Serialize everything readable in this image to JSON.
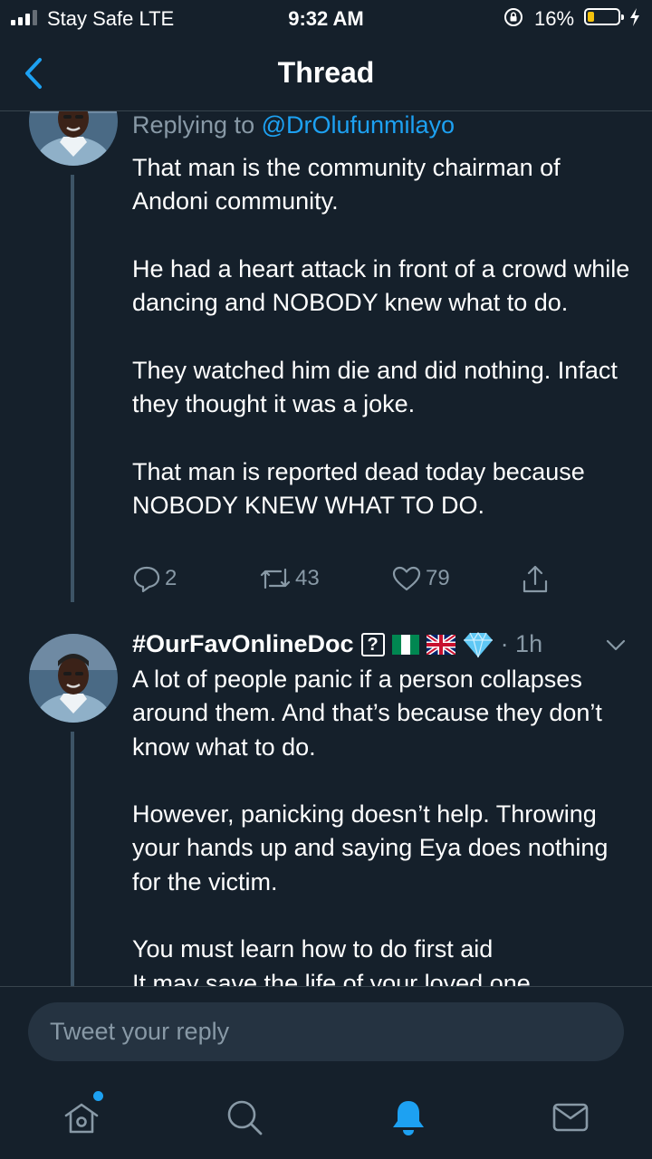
{
  "status_bar": {
    "carrier": "Stay Safe  LTE",
    "time": "9:32 AM",
    "battery_percent": "16%",
    "battery_level": 0.16,
    "battery_color": "#f4c20d"
  },
  "nav": {
    "title": "Thread",
    "back_icon": "chevron-left-icon"
  },
  "tweets": [
    {
      "replying_to_label": "Replying to",
      "replying_to_handle": "@DrOlufunmilayo",
      "text": "That man is the community chairman of Andoni community.\n\nHe had a heart attack in front of a crowd while dancing and NOBODY knew what to do.\n\nThey watched him die and did nothing. Infact they thought it was a joke.\n\nThat man is reported dead today because NOBODY KNEW WHAT TO DO.",
      "replies": "2",
      "retweets": "43",
      "likes": "79"
    },
    {
      "display_name": "#OurFavOnlineDoc",
      "badges": [
        "question-box",
        "nigeria-flag",
        "uk-flag",
        "gem"
      ],
      "time": "· 1h",
      "text": "A lot of people panic if a person collapses around them. And that’s because they don’t know what to do.\n\nHowever, panicking doesn’t help. Throwing your hands up and saying Eya does nothing for the victim.\n\nYou must learn how to do first aid\nIt may save the life of your loved one"
    }
  ],
  "reply_bar": {
    "placeholder": "Tweet your reply"
  },
  "tab_bar": {
    "items": [
      "home-icon",
      "search-icon",
      "notifications-icon",
      "messages-icon"
    ],
    "active": "notifications-icon"
  },
  "colors": {
    "background": "#15202b",
    "accent": "#1da1f2",
    "secondary_text": "#8899a6",
    "divider": "#38444d"
  }
}
